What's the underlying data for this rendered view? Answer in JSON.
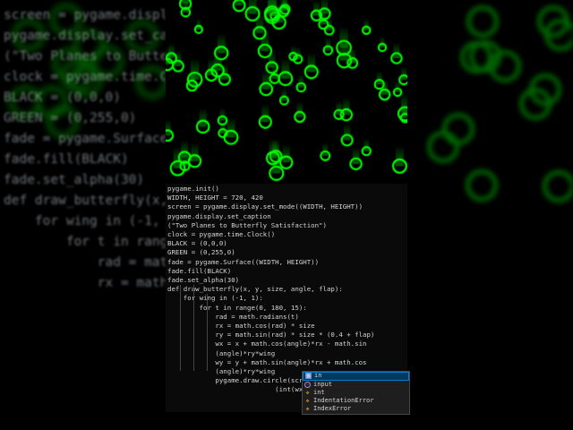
{
  "code_lines": [
    "pygame.init()",
    "WIDTH, HEIGHT = 720, 420",
    "screen = pygame.display.set_mode((WIDTH, HEIGHT))",
    "pygame.display.set_caption",
    "(\"Two Planes to Butterfly Satisfaction\")",
    "clock = pygame.time.Clock()",
    "BLACK = (0,0,0)",
    "GREEN = (0,255,0)",
    "fade = pygame.Surface((WIDTH, HEIGHT))",
    "fade.fill(BLACK)",
    "fade.set_alpha(30)",
    "def draw_butterfly(x, y, size, angle, flap):",
    "    for wing in (-1, 1):",
    "        for t in range(0, 180, 15):",
    "            rad = math.radians(t)",
    "            rx = math.cos(rad) * size",
    "            ry = math.sin(rad) * size * (0.4 + flap)",
    "            wx = x + math.cos(angle)*rx - math.sin",
    "            (angle)*ry*wing",
    "            wy = y + math.sin(angle)*rx + math.cos",
    "            (angle)*ry*wing",
    "            pygame.draw.circle(screen, GREEN,",
    "                           (int(wx), int())"
  ],
  "suggestions": [
    {
      "label": "in",
      "icon": "keyword-icon"
    },
    {
      "label": "input",
      "icon": "function-icon"
    },
    {
      "label": "int",
      "icon": "class-icon"
    },
    {
      "label": "IndentationError",
      "icon": "class-icon"
    },
    {
      "label": "IndexError",
      "icon": "class-icon"
    }
  ],
  "colors": {
    "green": "#00ff00",
    "selection": "#04395e"
  }
}
